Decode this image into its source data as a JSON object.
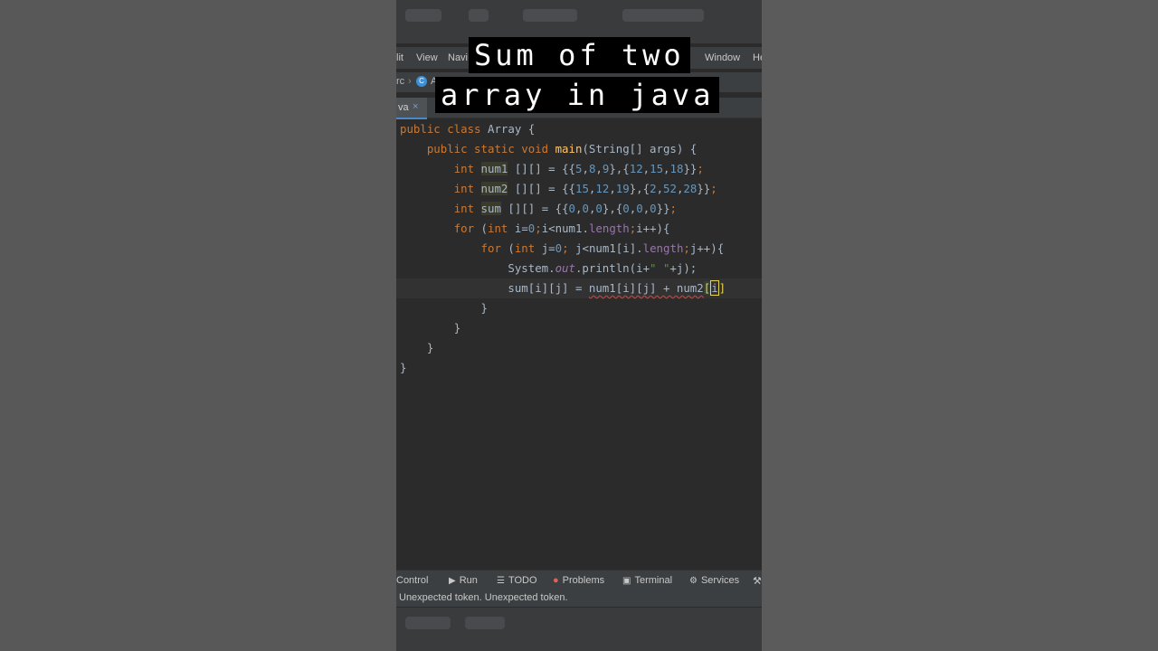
{
  "caption": {
    "line1": "Sum of two",
    "line2": "array in java"
  },
  "menu": {
    "edit": "lit",
    "view": "View",
    "navigate": "Navi",
    "window": "Window",
    "help": "He"
  },
  "breadcrumb": {
    "src": "rc",
    "file_initial": "A"
  },
  "tab": {
    "label": "va",
    "close": "×"
  },
  "code": {
    "line1": {
      "kw": "public class",
      "name": "Array",
      "brace": "{"
    },
    "line2": {
      "kw": "public static void",
      "fn": "main",
      "args": "(String[] args) {"
    },
    "line3": {
      "kw": "int",
      "var": "num1",
      "rest": " [][] = {{",
      "n1": "5",
      "n2": "8",
      "n3": "9",
      "n4": "12",
      "n5": "15",
      "n6": "18"
    },
    "line4": {
      "kw": "int",
      "var": "num2",
      "rest": " [][] = {{",
      "n1": "15",
      "n2": "12",
      "n3": "19",
      "n4": "2",
      "n5": "52",
      "n6": "28"
    },
    "line5": {
      "kw": "int",
      "var": "sum",
      "rest": " [][] = {{",
      "n1": "0",
      "n2": "0",
      "n3": "0",
      "n4": "0",
      "n5": "0",
      "n6": "0"
    },
    "line6": {
      "kw1": "for",
      "kw2": "int",
      "text": "i=",
      "zero": "0",
      "cond": "i<num1.",
      "fld": "length",
      "end": "i++){"
    },
    "line7": {
      "kw1": "for",
      "kw2": "int",
      "text": "j=",
      "zero": "0",
      "cond": "j<num1[i].",
      "fld": "length",
      "end": "j++){"
    },
    "line8": {
      "obj": "System.",
      "out": "out",
      "call": ".println(i+",
      "str": "\" \"",
      "end": "+j);"
    },
    "line9": {
      "text": "sum[i][j] = ",
      "err": "num1[i][j] + num2",
      "bracket": "[",
      "idx": "i",
      "close": "]"
    },
    "line10": "}",
    "line11": "}",
    "line12": "}",
    "line13": "}"
  },
  "toolwindows": {
    "version_control": "Control",
    "run": "Run",
    "todo": "TODO",
    "problems": "Problems",
    "terminal": "Terminal",
    "services": "Services"
  },
  "status": "Unexpected token. Unexpected token."
}
